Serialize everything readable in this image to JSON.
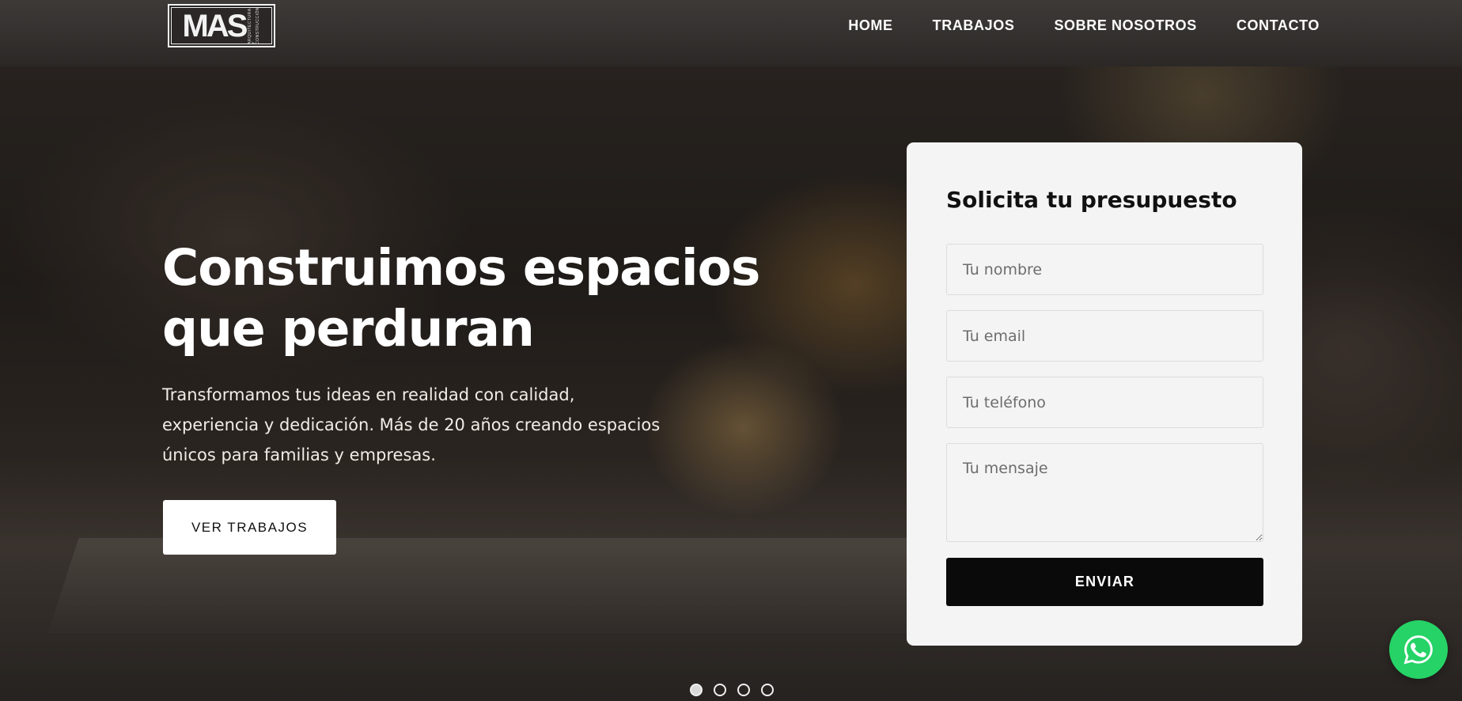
{
  "logo": {
    "text": "MAS",
    "subtitle": "ARQUITECTURA Y CONSTRUCCIÓN"
  },
  "nav": {
    "items": [
      {
        "label": "HOME"
      },
      {
        "label": "TRABAJOS"
      },
      {
        "label": "SOBRE NOSOTROS"
      },
      {
        "label": "CONTACTO"
      }
    ]
  },
  "hero": {
    "title": "Construimos espacios que perduran",
    "subtitle": "Transformamos tus ideas en realidad con calidad, experiencia y dedicación. Más de 20 años creando espacios únicos para familias y empresas.",
    "cta_label": "VER TRABAJOS"
  },
  "form": {
    "title": "Solicita tu presupuesto",
    "name_placeholder": "Tu nombre",
    "email_placeholder": "Tu email",
    "phone_placeholder": "Tu teléfono",
    "message_placeholder": "Tu mensaje",
    "submit_label": "ENVIAR"
  },
  "carousel": {
    "slide_count": 4,
    "active_index": 0
  },
  "whatsapp": {
    "icon": "whatsapp-icon",
    "color": "#25d366"
  },
  "colors": {
    "button_dark": "#0a0a0a",
    "card_bg": "#f4f4f4",
    "navbar_bg": "#2b2826"
  }
}
